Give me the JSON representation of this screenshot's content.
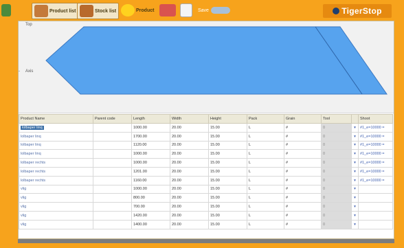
{
  "toolbar": {
    "product_list_label": "Product list",
    "stock_list_label": "Stock list",
    "product_label": "Product",
    "save_label": "Save",
    "brand": "TigerStop"
  },
  "drawing": {
    "top_label": "Top",
    "left_label": "Axis",
    "shape_color": "#57a3ee"
  },
  "grid": {
    "columns": [
      "Product Name",
      "Parent code",
      "Length",
      "Width",
      "Height",
      "Pack",
      "Grain",
      "Tool",
      "Shoot"
    ],
    "rows": [
      {
        "name": "lolbaper linq",
        "length": "1000.00",
        "width": "20.00",
        "height": "15.00",
        "pack": "L",
        "grain": "#",
        "tool": "0",
        "shoot": "#1_e=10000 ="
      },
      {
        "name": "lolbaper linq",
        "length": "1700.00",
        "width": "20.00",
        "height": "15.00",
        "pack": "L",
        "grain": "#",
        "tool": "0",
        "shoot": "#1_e=10000 ="
      },
      {
        "name": "lolbaper linq",
        "length": "1120.00",
        "width": "20.00",
        "height": "15.00",
        "pack": "L",
        "grain": "#",
        "tool": "0",
        "shoot": "#1_e=10000 ="
      },
      {
        "name": "lolbaper linq",
        "length": "1000.00",
        "width": "20.00",
        "height": "15.00",
        "pack": "L",
        "grain": "#",
        "tool": "0",
        "shoot": "#1_e=10000 ="
      },
      {
        "name": "lolbaper rechts",
        "length": "1000.00",
        "width": "20.00",
        "height": "15.00",
        "pack": "L",
        "grain": "#",
        "tool": "0",
        "shoot": "#1_e=10000 ="
      },
      {
        "name": "lolbaper rechts",
        "length": "1201.00",
        "width": "20.00",
        "height": "15.00",
        "pack": "L",
        "grain": "#",
        "tool": "0",
        "shoot": "#1_e=10000 ="
      },
      {
        "name": "lolbaper rechts",
        "length": "1160.00",
        "width": "20.00",
        "height": "15.00",
        "pack": "L",
        "grain": "#",
        "tool": "0",
        "shoot": "#1_e=10000 ="
      },
      {
        "name": "vlig",
        "length": "1000.00",
        "width": "20.00",
        "height": "15.00",
        "pack": "L",
        "grain": "#",
        "tool": "0",
        "shoot": ""
      },
      {
        "name": "vlig",
        "length": "800.00",
        "width": "20.00",
        "height": "15.00",
        "pack": "L",
        "grain": "#",
        "tool": "0",
        "shoot": ""
      },
      {
        "name": "vlig",
        "length": "700.00",
        "width": "20.00",
        "height": "15.00",
        "pack": "L",
        "grain": "#",
        "tool": "0",
        "shoot": ""
      },
      {
        "name": "vlig",
        "length": "1420.00",
        "width": "20.00",
        "height": "15.00",
        "pack": "L",
        "grain": "#",
        "tool": "0",
        "shoot": ""
      },
      {
        "name": "vlig",
        "length": "1400.00",
        "width": "20.00",
        "height": "15.00",
        "pack": "L",
        "grain": "#",
        "tool": "0",
        "shoot": ""
      }
    ]
  }
}
